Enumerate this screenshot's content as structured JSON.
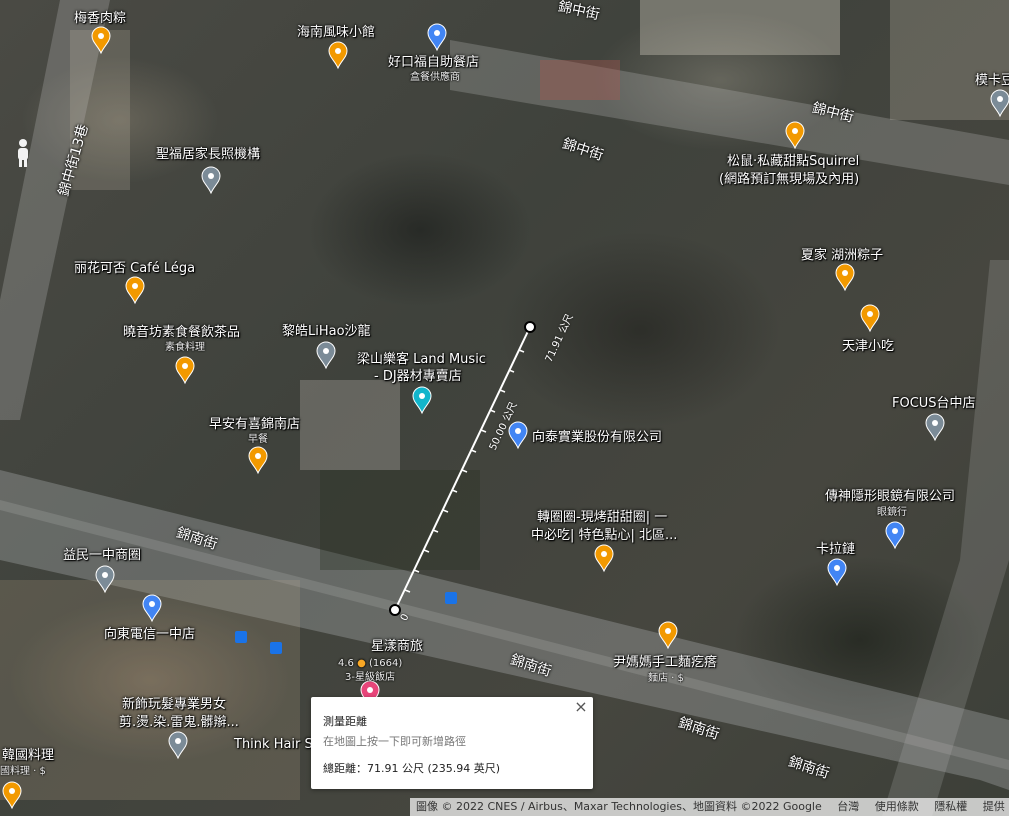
{
  "streets": [
    "錦中街",
    "錦中街",
    "錦中街",
    "錦中街13巷",
    "錦南街",
    "錦南街",
    "錦南街",
    "錦南街"
  ],
  "places": [
    {
      "name": "梅香肉粽",
      "icon": "food-icon"
    },
    {
      "name": "海南風味小館",
      "icon": "food-icon"
    },
    {
      "name": "好口福自助餐店",
      "sub": "盒餐供應商",
      "icon": "shopping-icon"
    },
    {
      "name": "聖福居家長照機構",
      "icon": "place-icon"
    },
    {
      "name": "松鼠·私藏甜點Squirrel",
      "sub2": "(網路預訂無現場及內用)",
      "icon": "food-icon"
    },
    {
      "name": "丽花可否 Café Léga",
      "icon": "cafe-icon"
    },
    {
      "name": "夏家 湖洲粽子",
      "icon": "food-icon"
    },
    {
      "name": "曉音坊素食餐飲茶品",
      "sub": "素食料理",
      "icon": "food-icon"
    },
    {
      "name": "黎皓LiHao沙龍",
      "icon": "place-icon"
    },
    {
      "name": "梁山樂客 Land Music",
      "sub2": "- DJ器材專賣店",
      "icon": "music-icon"
    },
    {
      "name": "天津小吃",
      "icon": "food-icon"
    },
    {
      "name": "FOCUS台中店",
      "icon": "place-icon"
    },
    {
      "name": "早安有喜錦南店",
      "sub": "早餐",
      "icon": "food-icon"
    },
    {
      "name": "向泰實業股份有限公司",
      "icon": "shopping-icon"
    },
    {
      "name": "傳神隱形眼鏡有限公司",
      "sub": "眼鏡行",
      "icon": "shopping-icon"
    },
    {
      "name": "轉圈圈-現烤甜甜圈| 一",
      "sub2": "中必吃| 特色點心| 北區...",
      "icon": "food-icon"
    },
    {
      "name": "卡拉鏈",
      "icon": "shopping-icon"
    },
    {
      "name": "益民一中商圈",
      "icon": "place-icon"
    },
    {
      "name": "向東電信一中店",
      "icon": "shopping-icon"
    },
    {
      "name": "星漾商旅",
      "rating": "4.6",
      "reviews": "(1664)",
      "sub": "3-星級飯店",
      "icon": "hotel-icon"
    },
    {
      "name": "尹媽媽手工麵疙瘩",
      "sub": "麵店 · $",
      "icon": "food-icon"
    },
    {
      "name": "新飾玩髮專業男女",
      "sub2": "剪.燙.染.雷鬼.髒辮...",
      "icon": "place-icon"
    },
    {
      "name": "Think Hair S",
      "icon": "place-icon"
    },
    {
      "name": "韓國料理",
      "sub": "國料理 · $",
      "icon": "food-icon"
    },
    {
      "name": "模卡豆",
      "icon": "place-icon"
    }
  ],
  "measure": {
    "scale_start": "0",
    "scale_mid": "50.00 公尺",
    "scale_end": "71.91 公尺"
  },
  "info": {
    "title": "測量距離",
    "hint": "在地圖上按一下即可新增路徑",
    "total": "總距離：71.91 公尺 (235.94 英尺)",
    "close": "×"
  },
  "footer": {
    "attribution": "圖像 © 2022 CNES / Airbus、Maxar Technologies、地圖資料 ©2022 Google",
    "region": "台灣",
    "terms": "使用條款",
    "privacy": "隱私權",
    "feedback": "提供"
  },
  "colors": {
    "food_pin": "#f29900",
    "place_pin": "#7b8b97",
    "shop_pin": "#4285f4",
    "music_pin": "#12b5cb",
    "hotel_pin": "#e8457a",
    "bus_stop": "#1a73e8"
  }
}
